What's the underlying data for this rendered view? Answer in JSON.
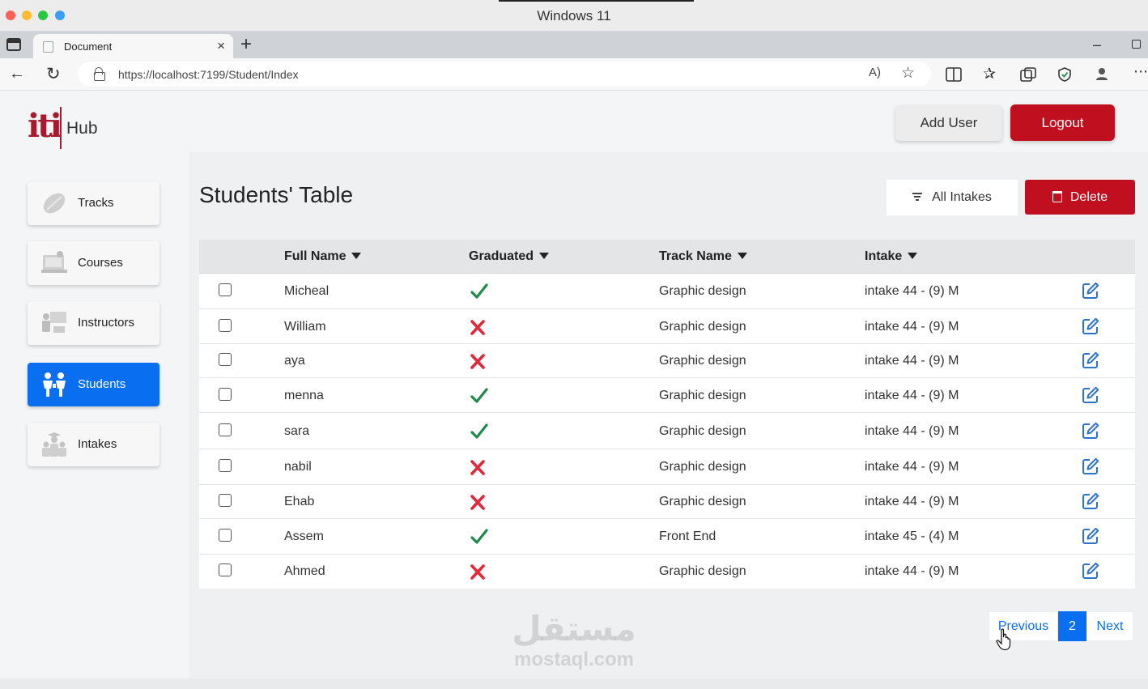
{
  "window": {
    "title": "Windows 11"
  },
  "browser": {
    "tab_title": "Document",
    "url": "https://localhost:7199/Student/Index",
    "read_aloud_glyph": "A)"
  },
  "app": {
    "brand": "Hub",
    "logo_mark": "iti",
    "add_user_label": "Add User",
    "logout_label": "Logout"
  },
  "sidebar": {
    "items": [
      {
        "label": "Tracks",
        "icon": "tracks-icon",
        "active": false
      },
      {
        "label": "Courses",
        "icon": "courses-icon",
        "active": false
      },
      {
        "label": "Instructors",
        "icon": "instructors-icon",
        "active": false
      },
      {
        "label": "Students",
        "icon": "students-icon",
        "active": true
      },
      {
        "label": "Intakes",
        "icon": "intakes-icon",
        "active": false
      }
    ]
  },
  "page": {
    "title": "Students' Table",
    "filter_label": "All Intakes",
    "delete_label": "Delete"
  },
  "table": {
    "columns": [
      "Full Name",
      "Graduated",
      "Track Name",
      "Intake"
    ],
    "rows": [
      {
        "name": "Micheal",
        "graduated": true,
        "track": "Graphic design",
        "intake": "intake 44 - (9) M"
      },
      {
        "name": "William",
        "graduated": false,
        "track": "Graphic design",
        "intake": "intake 44 - (9) M"
      },
      {
        "name": "aya",
        "graduated": false,
        "track": "Graphic design",
        "intake": "intake 44 - (9) M"
      },
      {
        "name": "menna",
        "graduated": true,
        "track": "Graphic design",
        "intake": "intake 44 - (9) M"
      },
      {
        "name": "sara",
        "graduated": true,
        "track": "Graphic design",
        "intake": "intake 44 - (9) M"
      },
      {
        "name": "nabil",
        "graduated": false,
        "track": "Graphic design",
        "intake": "intake 44 - (9) M"
      },
      {
        "name": "Ehab",
        "graduated": false,
        "track": "Graphic design",
        "intake": "intake 44 - (9) M"
      },
      {
        "name": "Assem",
        "graduated": true,
        "track": "Front End",
        "intake": "intake 45 - (4) M"
      },
      {
        "name": "Ahmed",
        "graduated": false,
        "track": "Graphic design",
        "intake": "intake 44 - (9) M"
      }
    ]
  },
  "pagination": {
    "previous_label": "Previous",
    "current_page": "2",
    "next_label": "Next"
  },
  "watermark": {
    "arabic": "مستقل",
    "latin": "mostaql.com"
  },
  "colors": {
    "accent_blue": "#0a6ef0",
    "danger_red": "#c0101f",
    "brand_red": "#a6192e",
    "check_green": "#1e8a4c",
    "cross_red": "#e0293a",
    "edit_blue": "#2f73c8"
  }
}
